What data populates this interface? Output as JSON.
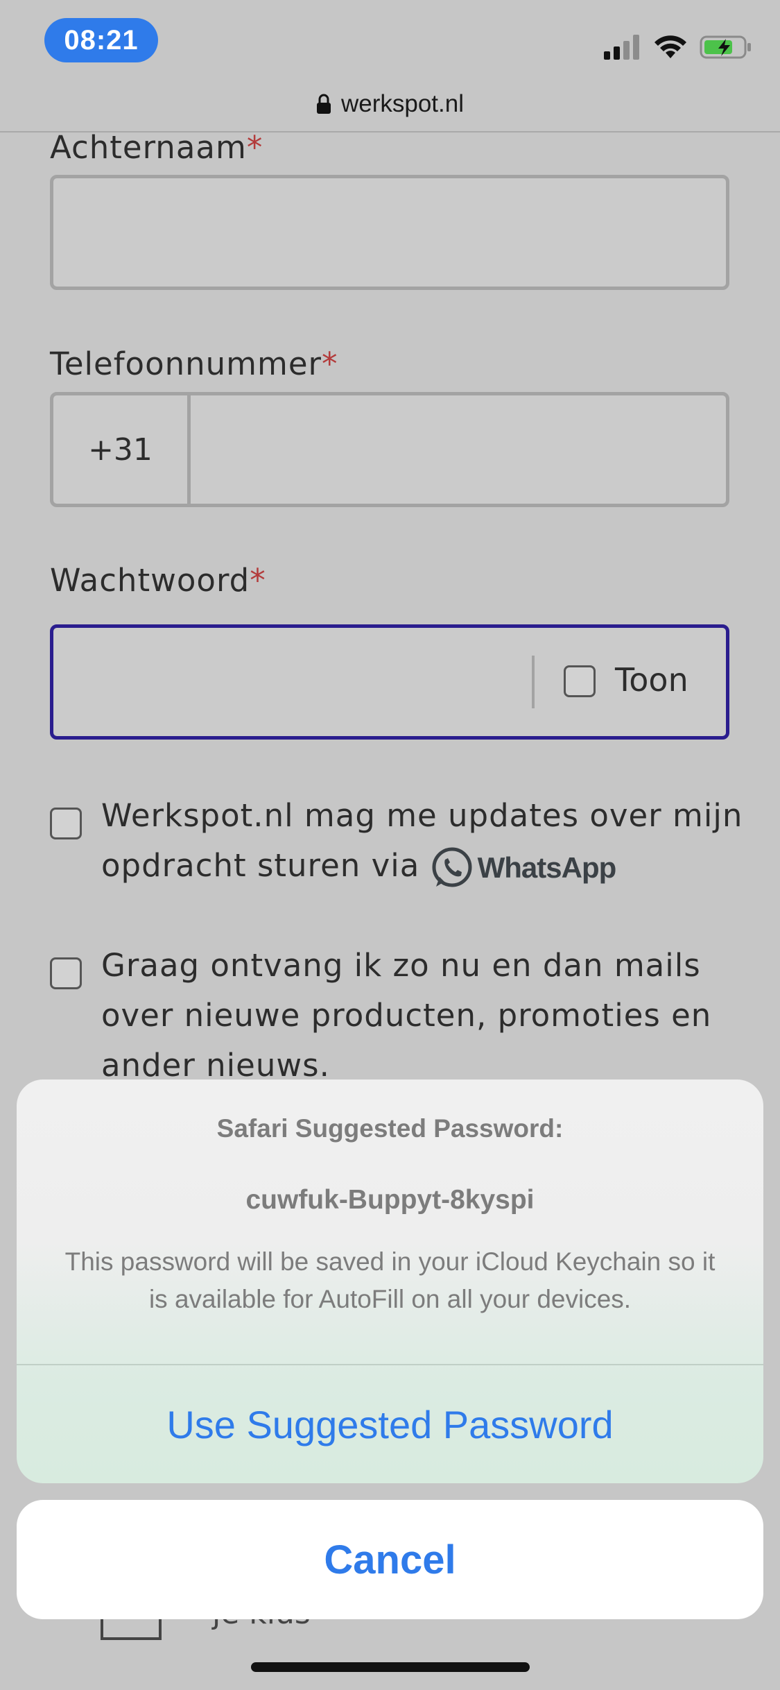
{
  "status_bar": {
    "time": "08:21",
    "icons": [
      "cellular-signal-icon",
      "wifi-icon",
      "battery-charging-icon"
    ]
  },
  "browser": {
    "url": "werkspot.nl"
  },
  "form": {
    "required_marker": "*",
    "last_name": {
      "label": "Achternaam",
      "value": ""
    },
    "phone": {
      "label": "Telefoonnummer",
      "prefix": "+31",
      "value": ""
    },
    "password": {
      "label": "Wachtwoord",
      "value": "",
      "show_label": "Toon",
      "show_checked": false
    },
    "whatsapp_optin": {
      "text": "Werkspot.nl mag me updates over mijn opdracht sturen via",
      "brand": "WhatsApp",
      "checked": false
    },
    "newsletter_optin": {
      "text": "Graag ontvang ik zo nu en dan mails over nieuwe producten, promoties en ander nieuws.",
      "checked": false
    },
    "bottom_peek_text": "je klus"
  },
  "action_sheet": {
    "title": "Safari Suggested Password:",
    "suggested_password": "cuwfuk-Buppyt-8kyspi",
    "description": "This password will be saved in your iCloud Keychain so it is available for AutoFill on all your devices.",
    "use_button": "Use Suggested Password",
    "cancel_button": "Cancel"
  },
  "colors": {
    "accent": "#2f7bea",
    "focus_border": "#2a1d8e",
    "required": "#b33b3b"
  }
}
